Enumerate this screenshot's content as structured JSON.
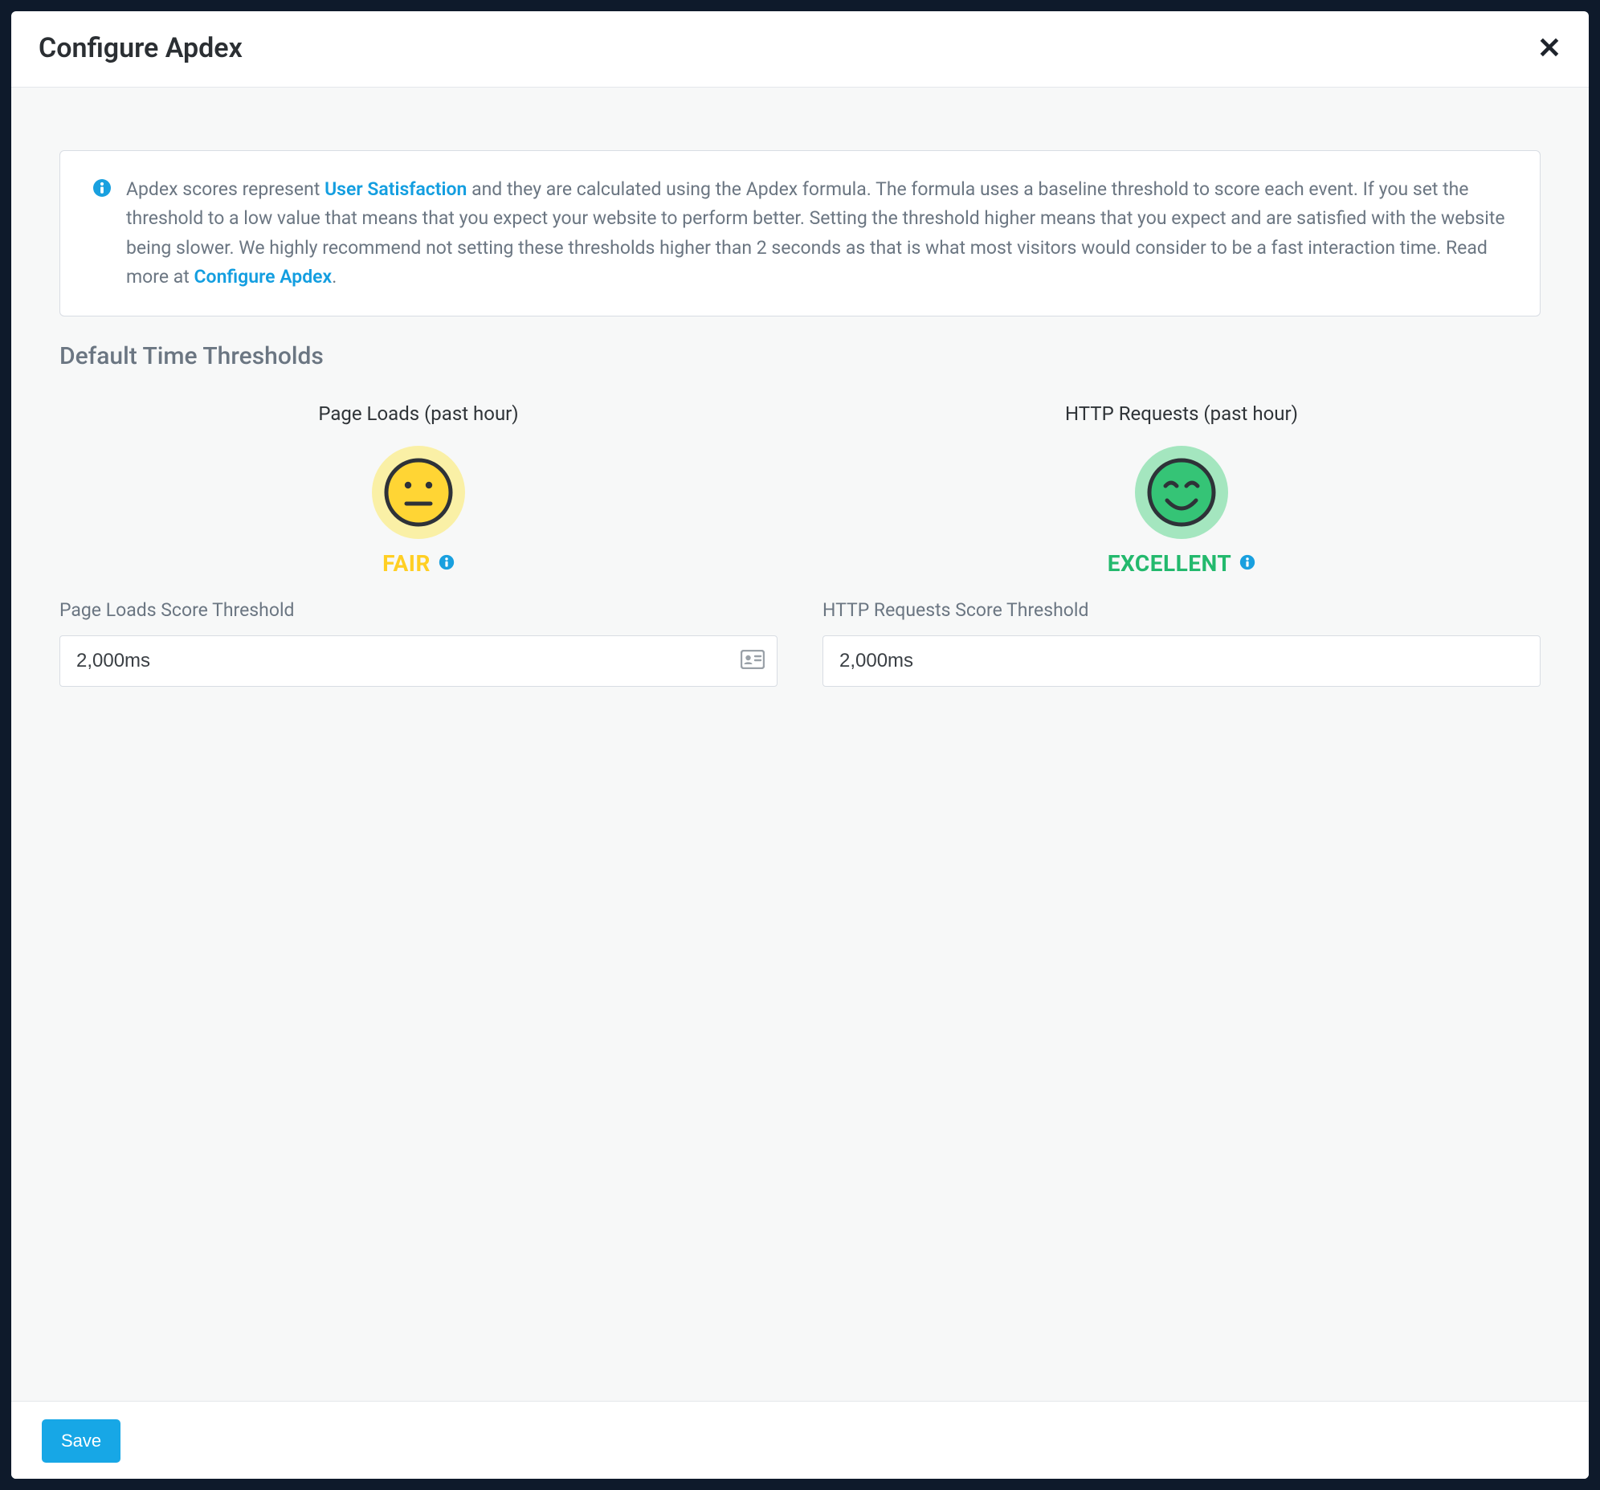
{
  "modal": {
    "title": "Configure Apdex",
    "info": {
      "pre": "Apdex scores represent ",
      "link1": "User Satisfaction",
      "mid": " and they are calculated using the Apdex formula. The formula uses a baseline threshold to score each event. If you set the threshold to a low value that means that you expect your website to perform better. Setting the threshold higher means that you expect and are satisfied with the website being slower. We highly recommend not setting these thresholds higher than 2 seconds as that is what most visitors would consider to be a fast interaction time. Read more at ",
      "link2": "Configure Apdex",
      "post": "."
    },
    "section_title": "Default Time Thresholds",
    "columns": {
      "page_loads": {
        "title": "Page Loads (past hour)",
        "rating": "FAIR",
        "field_label": "Page Loads Score Threshold",
        "value": "2,000ms"
      },
      "http_requests": {
        "title": "HTTP Requests (past hour)",
        "rating": "EXCELLENT",
        "field_label": "HTTP Requests Score Threshold",
        "value": "2,000ms"
      }
    },
    "save_label": "Save"
  }
}
